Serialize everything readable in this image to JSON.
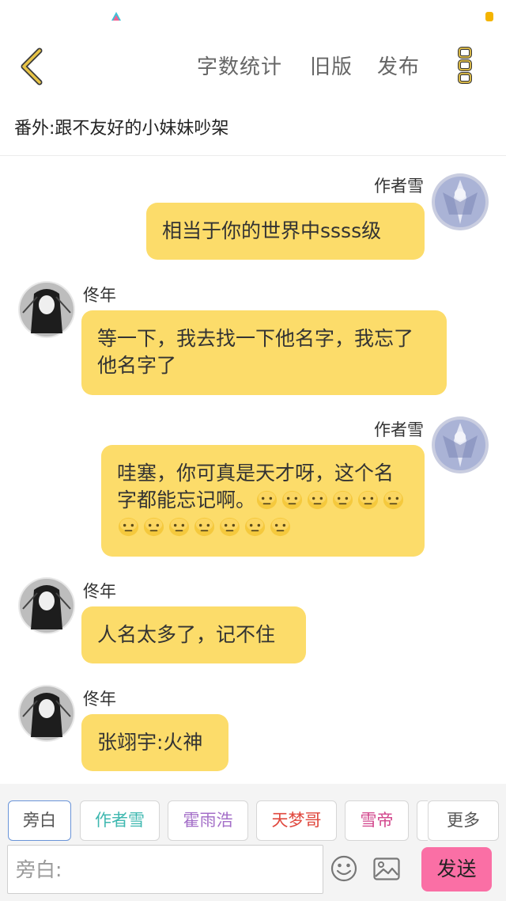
{
  "top_bar": {
    "word_count_label": "字数统计",
    "old_version_label": "旧版",
    "publish_label": "发布"
  },
  "chapter": {
    "title": "番外:跟不友好的小妹妹吵架"
  },
  "messages": [
    {
      "sender": "作者雪",
      "side": "right",
      "text": "相当于你的世界中ssss级"
    },
    {
      "sender": "佟年",
      "side": "left",
      "text": "等一下，我去找一下他名字，我忘了他名字了"
    },
    {
      "sender": "作者雪",
      "side": "right",
      "text": "哇塞，你可真是天才呀，这个名字都能忘记啊。",
      "emoji_count": 13
    },
    {
      "sender": "佟年",
      "side": "left",
      "text": "人名太多了，记不住"
    },
    {
      "sender": "佟年",
      "side": "left",
      "text": "张翊宇:火神"
    }
  ],
  "roles": [
    {
      "label": "旁白",
      "color": "#555555"
    },
    {
      "label": "作者雪",
      "color": "#3fb8b0"
    },
    {
      "label": "霍雨浩",
      "color": "#a46fc8"
    },
    {
      "label": "天梦哥",
      "color": "#e0483e"
    },
    {
      "label": "雪帝",
      "color": "#d2468c"
    }
  ],
  "more_roles_label": "更多",
  "input": {
    "placeholder": "旁白:"
  },
  "send_label": "发送",
  "colors": {
    "bubble": "#fcdc6a",
    "send": "#fa6fa5",
    "back_arrow": "#e8c447",
    "more_dots": "#e8c447"
  },
  "icons": {
    "back": "chevron-left-icon",
    "more": "vertical-dots-icon",
    "emoji": "smiley-icon",
    "image": "image-icon"
  }
}
